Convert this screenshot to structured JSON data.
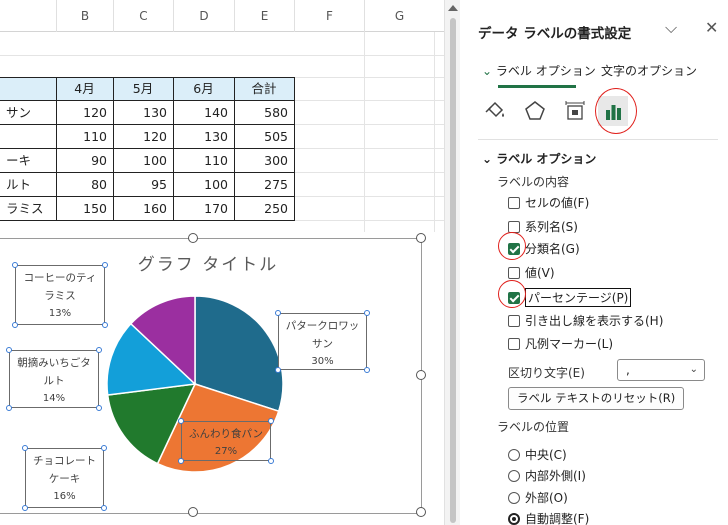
{
  "sheet": {
    "columns": [
      "B",
      "C",
      "D",
      "E",
      "F",
      "G"
    ],
    "headers": [
      "4月",
      "5月",
      "6月",
      "合計"
    ],
    "rows": [
      {
        "label": "サン",
        "values": [
          "120",
          "130",
          "140",
          "580"
        ]
      },
      {
        "label": "",
        "values": [
          "110",
          "120",
          "130",
          "505"
        ]
      },
      {
        "label": "ーキ",
        "values": [
          "90",
          "100",
          "110",
          "300"
        ]
      },
      {
        "label": "ルト",
        "values": [
          "80",
          "95",
          "100",
          "275"
        ]
      },
      {
        "label": "ラミス",
        "values": [
          "150",
          "160",
          "170",
          "250"
        ]
      }
    ]
  },
  "chart_data": {
    "type": "pie",
    "title": "グラフ タイトル",
    "slices": [
      {
        "name": "バタークロワッサン",
        "percent": 30,
        "color": "#1f6b8c"
      },
      {
        "name": "ふんわり食パン",
        "percent": 27,
        "color": "#ed7633"
      },
      {
        "name": "チョコレートケーキ",
        "percent": 16,
        "color": "#217a2d"
      },
      {
        "name": "朝摘みいちごタルト",
        "percent": 14,
        "color": "#139fd9"
      },
      {
        "name": "コーヒーのティラミス",
        "percent": 13,
        "color": "#9b2fa0"
      }
    ],
    "labels": [
      {
        "line1": "コーヒーのティ",
        "line2": "ラミス",
        "pct": "13%"
      },
      {
        "line1": "パタークロワッ",
        "line2": "サン",
        "pct": "30%"
      },
      {
        "line1": "朝摘みいちごタ",
        "line2": "ルト",
        "pct": "14%"
      },
      {
        "line1": "ふんわり食パン",
        "line2": "",
        "pct": "27%"
      },
      {
        "line1": "チョコレート",
        "line2": "ケーキ",
        "pct": "16%"
      }
    ]
  },
  "pane": {
    "title": "データ ラベルの書式設定",
    "tabs": [
      "ラベル オプション",
      "文字のオプション"
    ],
    "section": "ラベル オプション",
    "content_heading": "ラベルの内容",
    "options": [
      {
        "label": "セルの値(F)",
        "checked": false
      },
      {
        "label": "系列名(S)",
        "checked": false
      },
      {
        "label": "分類名(G)",
        "checked": true
      },
      {
        "label": "値(V)",
        "checked": false
      },
      {
        "label": "パーセンテージ(P)",
        "checked": true
      },
      {
        "label": "引き出し線を表示する(H)",
        "checked": false
      },
      {
        "label": "凡例マーカー(L)",
        "checked": false
      }
    ],
    "separator_label": "区切り文字(E)",
    "separator_value": ",",
    "reset_button": "ラベル テキストのリセット(R)",
    "position_heading": "ラベルの位置",
    "positions": [
      {
        "label": "中央(C)",
        "selected": false
      },
      {
        "label": "内部外側(I)",
        "selected": false
      },
      {
        "label": "外部(O)",
        "selected": false
      },
      {
        "label": "自動調整(F)",
        "selected": true
      }
    ]
  }
}
